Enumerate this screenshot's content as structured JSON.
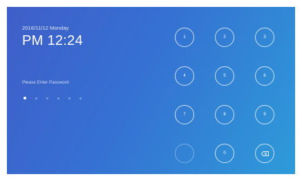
{
  "status": {
    "date": "2016/11/12  Monday",
    "time": "PM 12:24"
  },
  "password": {
    "prompt": "Please Enter Password",
    "length": 6,
    "entered": 1
  },
  "keypad": {
    "keys": [
      "1",
      "2",
      "3",
      "4",
      "5",
      "6",
      "7",
      "8",
      "9",
      "",
      "0",
      ""
    ],
    "empty_key_icon": "blank",
    "delete_key_icon": "backspace-icon"
  },
  "colors": {
    "gradient_start": "#3f5ec8",
    "gradient_end": "#2e9bd9"
  }
}
